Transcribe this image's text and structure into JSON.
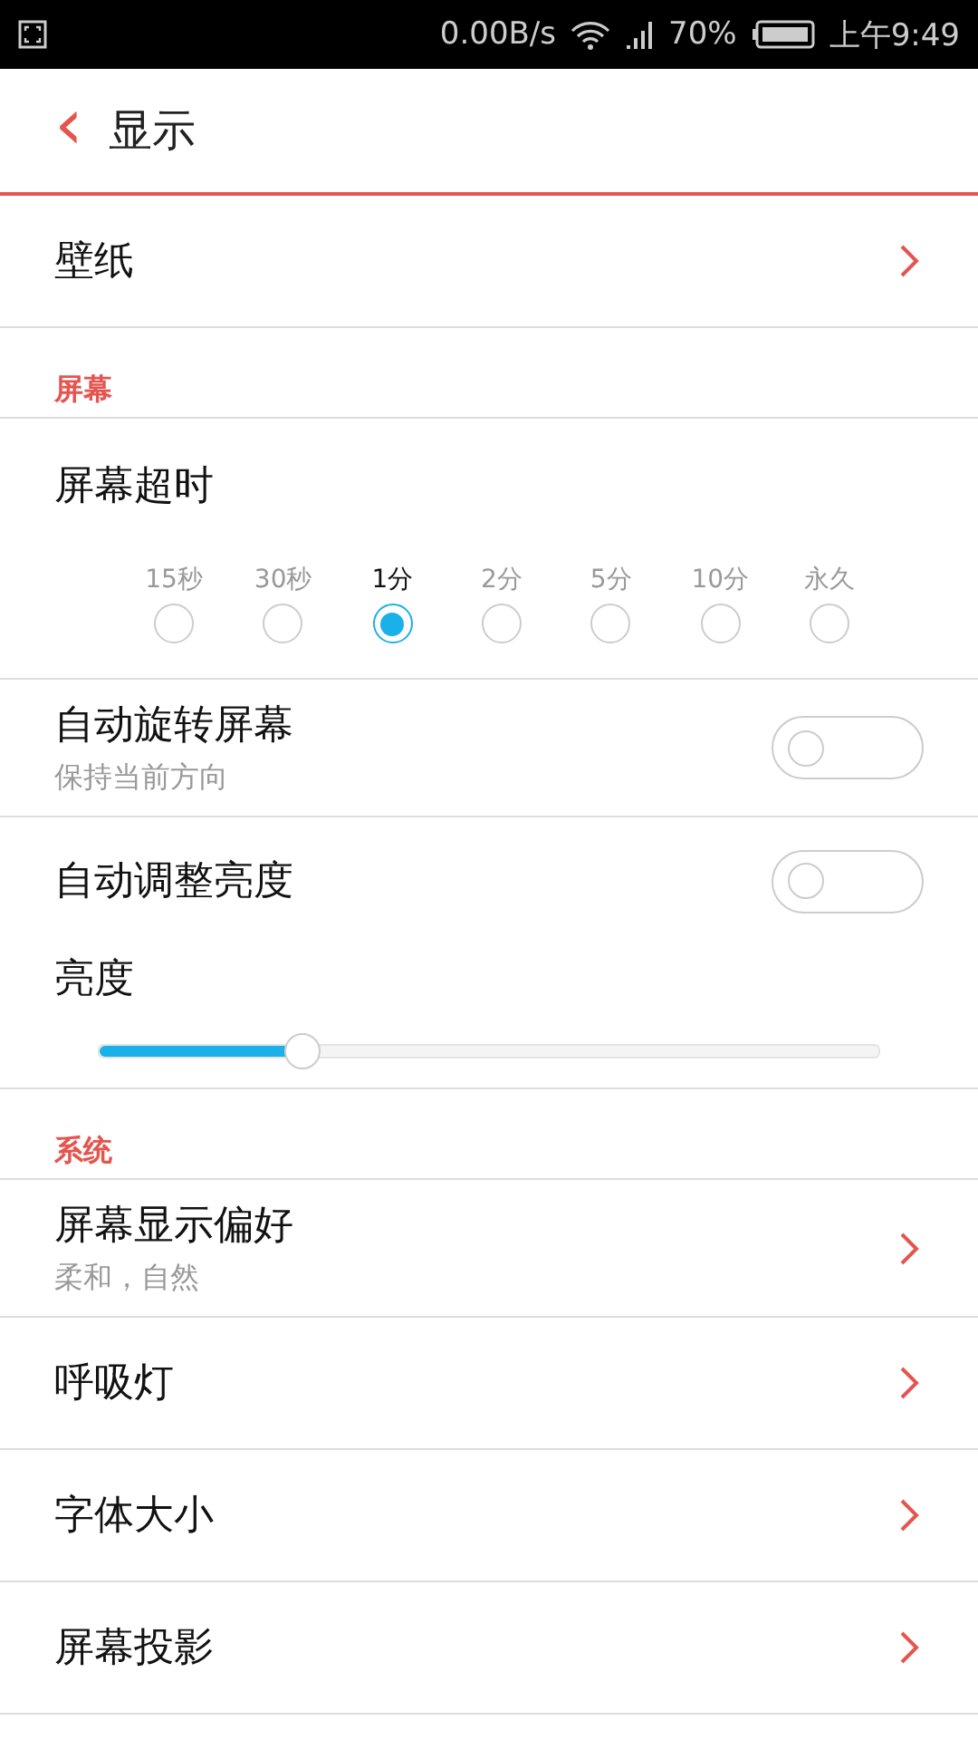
{
  "status_bar": {
    "network_speed": "0.00B/s",
    "battery": "70%",
    "time": "上午9:49"
  },
  "header": {
    "back": "‹",
    "title": "显示"
  },
  "rows": [
    {
      "kind": "link",
      "title": "壁纸"
    },
    {
      "kind": "section",
      "title": "屏幕"
    },
    {
      "kind": "options",
      "title": "屏幕超时",
      "options": [
        {
          "label": "15秒",
          "selected": false
        },
        {
          "label": "30秒",
          "selected": false
        },
        {
          "label": "1分",
          "selected": true
        },
        {
          "label": "2分",
          "selected": false
        },
        {
          "label": "5分",
          "selected": false
        },
        {
          "label": "10分",
          "selected": false
        },
        {
          "label": "永久",
          "selected": false
        }
      ]
    },
    {
      "kind": "toggle",
      "title": "自动旋转屏幕",
      "subtitle": "保持当前方向",
      "on": false
    },
    {
      "kind": "toggle",
      "title": "自动调整亮度",
      "on": false
    },
    {
      "kind": "slider",
      "title": "亮度",
      "level": 0.26
    },
    {
      "kind": "section",
      "title": "系统"
    },
    {
      "kind": "link",
      "title": "屏幕显示偏好",
      "subtitle": "柔和，自然"
    },
    {
      "kind": "link",
      "title": "呼吸灯"
    },
    {
      "kind": "link",
      "title": "字体大小"
    },
    {
      "kind": "link",
      "title": "屏幕投影"
    }
  ]
}
